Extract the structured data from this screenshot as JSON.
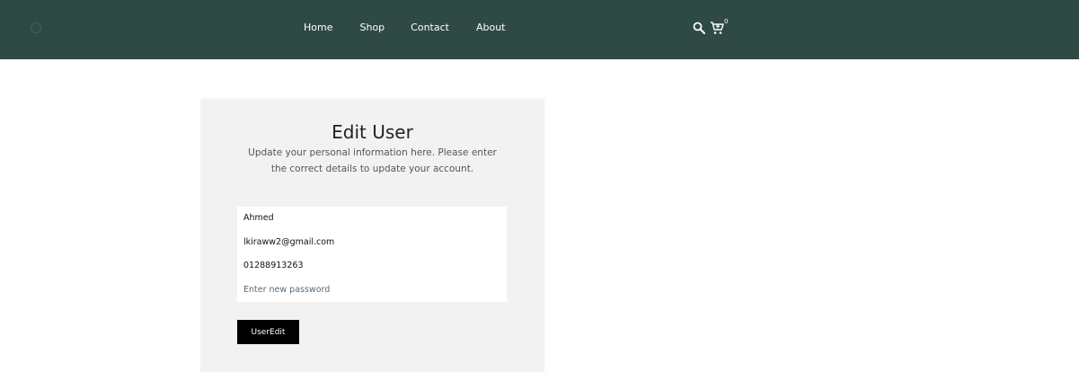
{
  "nav": {
    "links": [
      "Home",
      "Shop",
      "Contact",
      "About"
    ],
    "cart_count": "0"
  },
  "icons": {
    "logo": "brand-logo",
    "search": "search-icon",
    "cart": "cart-icon"
  },
  "colors": {
    "navbar_bg": "#2f4a45",
    "card_bg": "#f2f2f2",
    "button_bg": "#000000"
  },
  "form": {
    "title": "Edit User",
    "subtitle": "Update your personal information here. Please enter the correct details to update your account.",
    "name_value": "Ahmed",
    "email_value": "lkiraww2@gmail.com",
    "phone_value": "01288913263",
    "password_placeholder": "Enter new password",
    "submit_label": "UserEdit"
  }
}
